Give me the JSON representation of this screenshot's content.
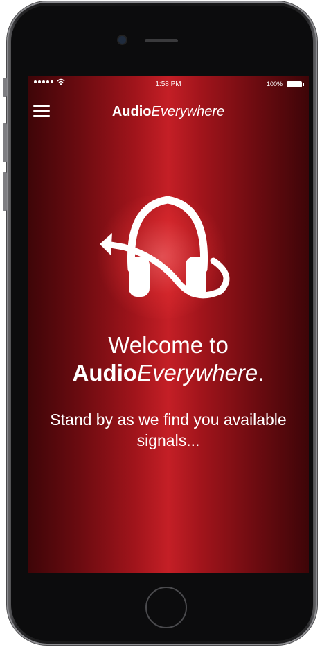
{
  "status_bar": {
    "time": "1:58 PM",
    "battery": "100%"
  },
  "header": {
    "brand_bold": "Audio",
    "brand_italic": "Everywhere"
  },
  "welcome": {
    "line1": "Welcome to",
    "brand_bold": "Audio",
    "brand_italic": "Everywhere",
    "brand_end": ".",
    "message": "Stand by as we find you available signals..."
  },
  "icons": {
    "menu": "hamburger-menu-icon",
    "logo": "headphones-logo-icon",
    "wifi": "wifi-icon",
    "battery": "battery-icon"
  },
  "colors": {
    "background_center": "#c41f26",
    "background_edge": "#3e0508",
    "text": "#ffffff"
  }
}
